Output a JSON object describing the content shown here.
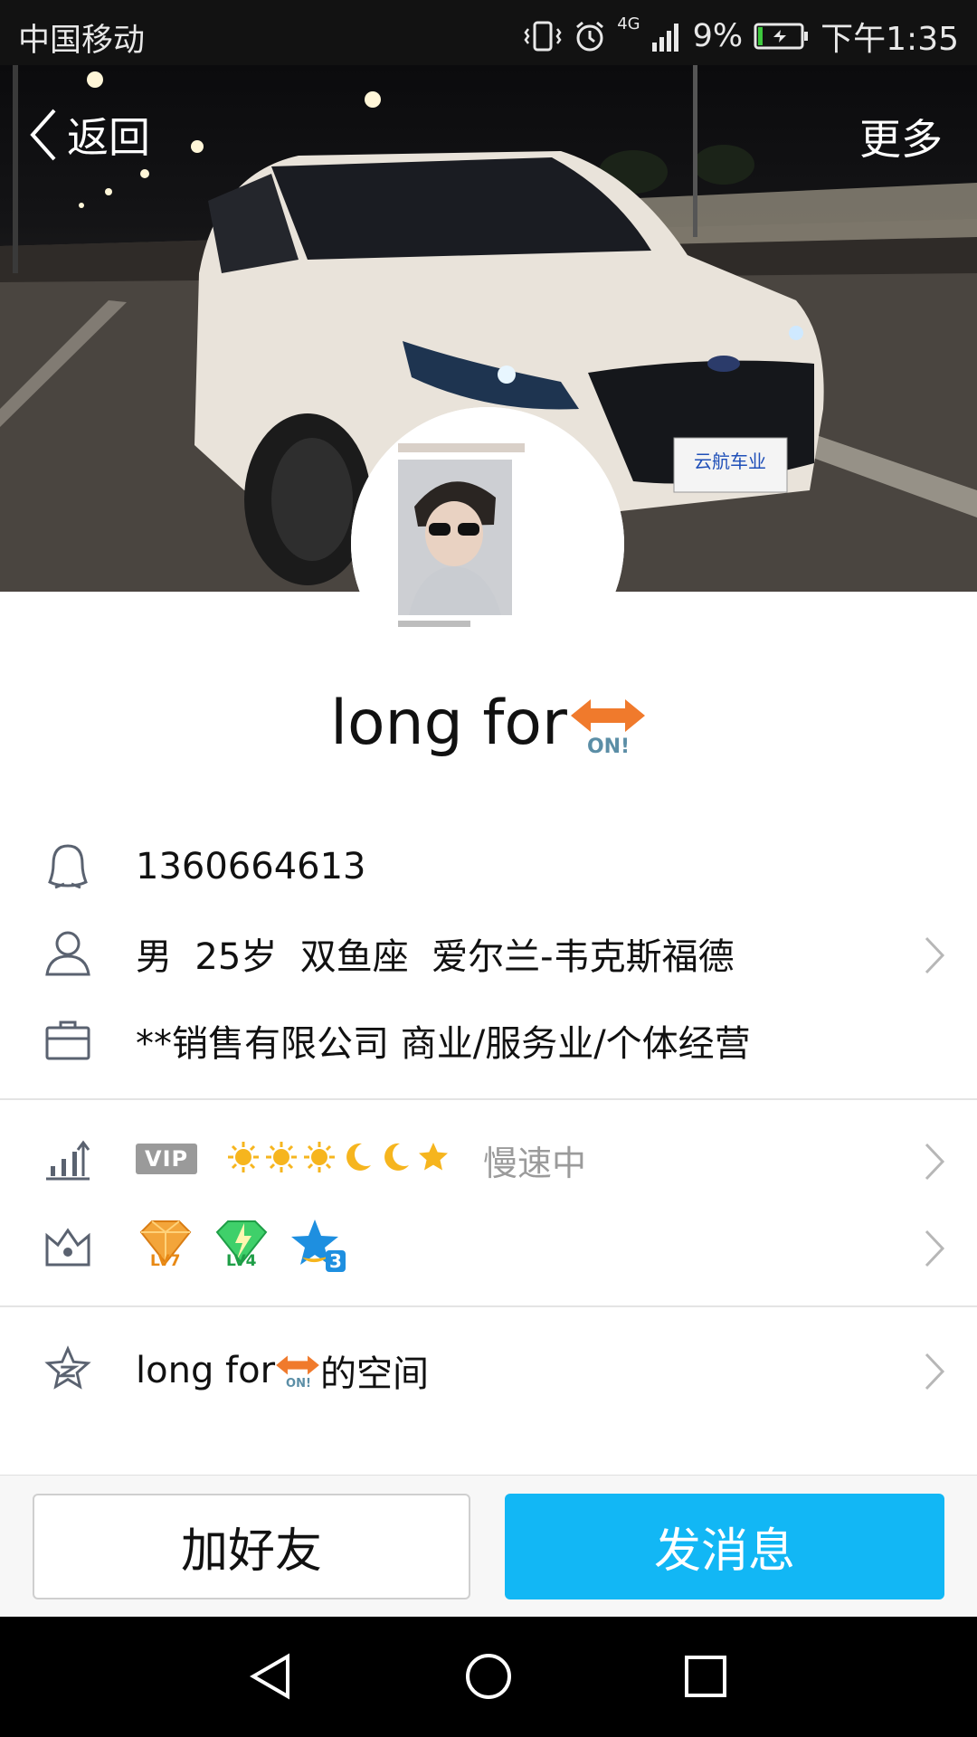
{
  "status_bar": {
    "carrier": "中国移动",
    "network": "4G",
    "battery": "9%",
    "time": "下午1:35"
  },
  "nav": {
    "back_label": "返回",
    "more_label": "更多"
  },
  "cover": {
    "plate_text": "云航车业"
  },
  "profile": {
    "nickname": "long for",
    "badge_text": "ON!",
    "qq_number": "1360664613",
    "basic_info": "男  25岁  双鱼座  爱尔兰-韦克斯福德",
    "company": "**销售有限公司 商业/服务业/个体经营",
    "vip_label": "VIP",
    "level_status": "慢速中",
    "badges": [
      "LV7",
      "LV4",
      "3"
    ],
    "space_suffix": "的空间"
  },
  "actions": {
    "add_friend": "加好友",
    "send_message": "发消息"
  },
  "colors": {
    "accent": "#12b7f5",
    "badge_orange": "#f07a2c",
    "icon_gray": "#5a6270"
  }
}
